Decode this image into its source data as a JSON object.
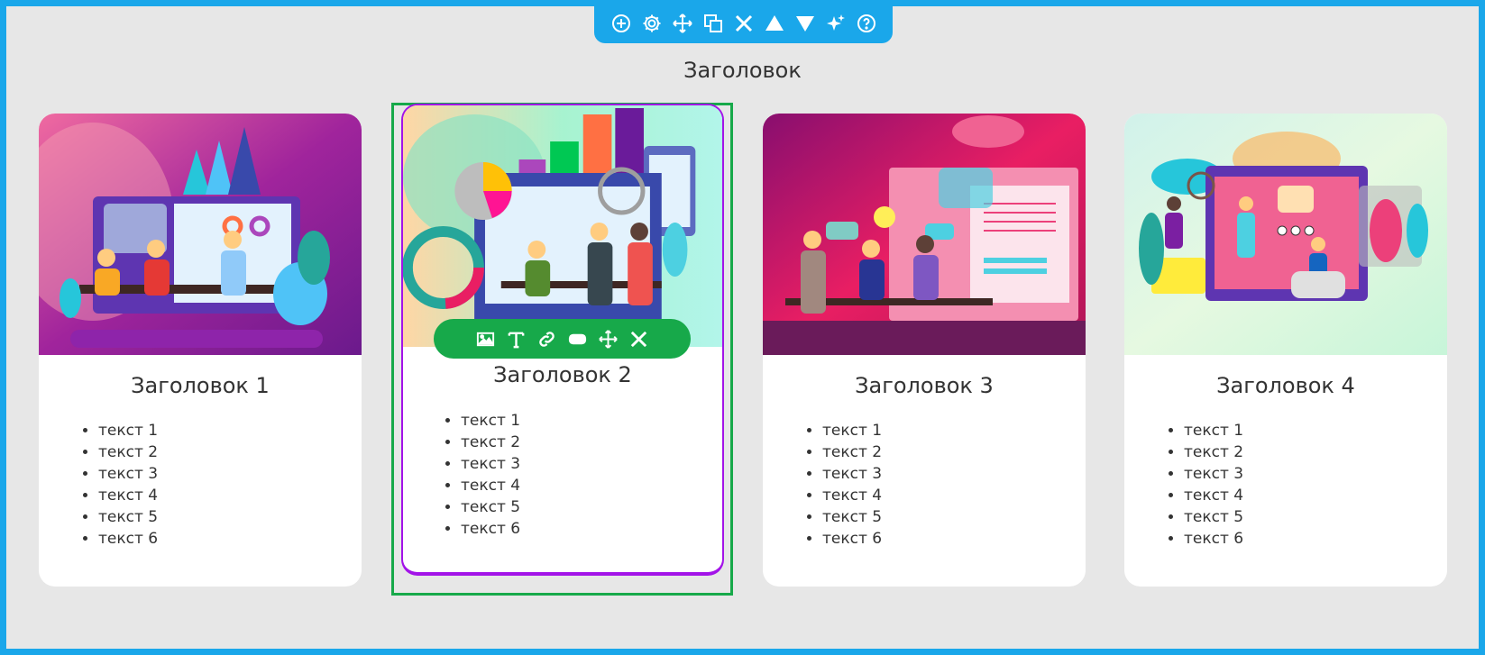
{
  "section": {
    "title": "Заголовок"
  },
  "top_toolbar": {
    "buttons": [
      "add-icon",
      "settings-icon",
      "move-icon",
      "duplicate-icon",
      "delete-icon",
      "move-up-icon",
      "move-down-icon",
      "magic-icon",
      "help-icon"
    ]
  },
  "card_toolbar": {
    "buttons": [
      "image-icon",
      "text-icon",
      "link-icon",
      "button-icon",
      "move-icon",
      "delete-icon"
    ]
  },
  "cards": [
    {
      "title": "Заголовок 1",
      "items": [
        "текст 1",
        "текст 2",
        "текст 3",
        "текст 4",
        "текст 5",
        "текст 6"
      ]
    },
    {
      "title": "Заголовок 2",
      "items": [
        "текст 1",
        "текст 2",
        "текст 3",
        "текст 4",
        "текст 5",
        "текст 6"
      ]
    },
    {
      "title": "Заголовок 3",
      "items": [
        "текст 1",
        "текст 2",
        "текст 3",
        "текст 4",
        "текст 5",
        "текст 6"
      ]
    },
    {
      "title": "Заголовок 4",
      "items": [
        "текст 1",
        "текст 2",
        "текст 3",
        "текст 4",
        "текст 5",
        "текст 6"
      ]
    }
  ],
  "colors": {
    "frame": "#1aa7ea",
    "selection": "#17a94a",
    "active_card_border": "#a313e8"
  }
}
